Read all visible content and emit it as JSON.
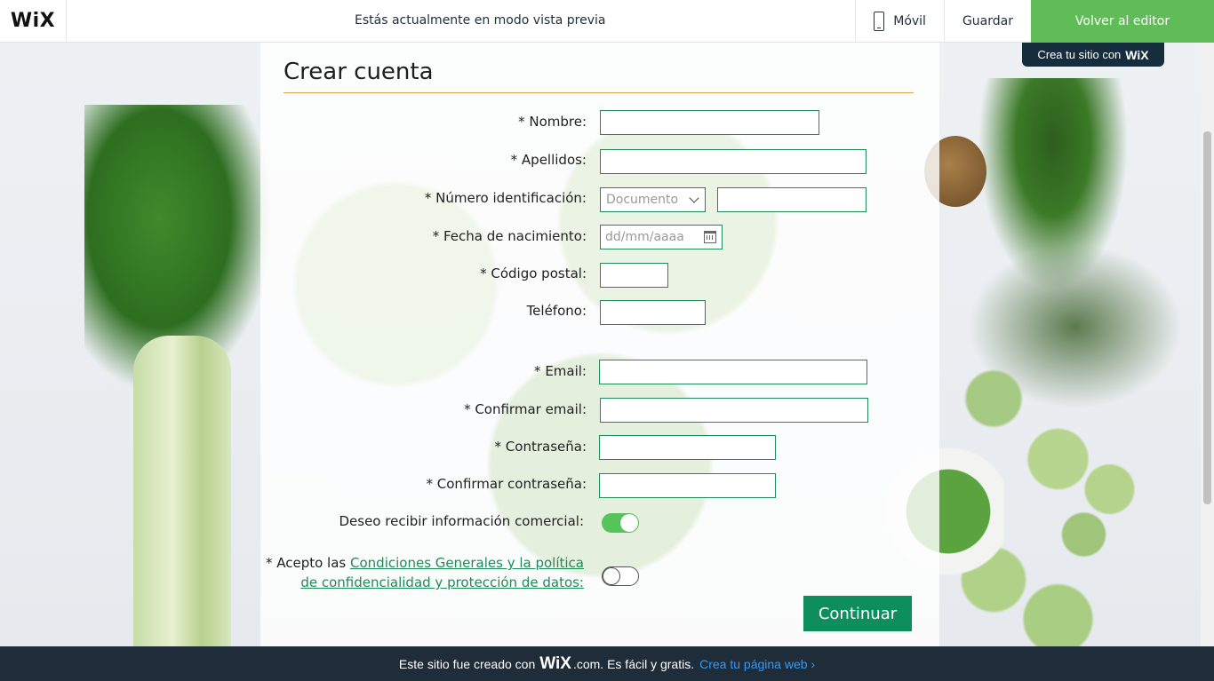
{
  "topbar": {
    "logo": "WiX",
    "preview_text": "Estás actualmente en modo vista previa",
    "mobile_label": "Móvil",
    "save_label": "Guardar",
    "editor_label": "Volver al editor"
  },
  "badge": {
    "text": "Crea tu sitio con",
    "brand": "WiX"
  },
  "form": {
    "title": "Crear cuenta",
    "fields": {
      "nombre": "* Nombre:",
      "apellidos": "* Apellidos:",
      "numero": "* Número identificación:",
      "fecha": "* Fecha de nacimiento:",
      "postal": "* Código postal:",
      "telefono": "Teléfono:",
      "email": "* Email:",
      "confirm_email": "* Confirmar email:",
      "password": "* Contraseña:",
      "confirm_password": "* Confirmar contraseña:",
      "comercial": "Deseo recibir información comercial:"
    },
    "document_select": "Documento",
    "date_placeholder": "dd/mm/aaaa",
    "terms_prefix": "* Acepto las",
    "terms_link_1": "Condiciones Generales y la política",
    "terms_link_2": "de confidencialidad y protección de datos:",
    "continue_label": "Continuar",
    "comercial_on": true,
    "terms_on": false
  },
  "footer": {
    "text_before": "Este sitio fue creado con",
    "brand": "WiX",
    "text_after": ".com. Es fácil y gratis.",
    "link": "Crea tu página web ›"
  },
  "colors": {
    "accent_green": "#60bc57",
    "input_border": "#1f8a5a",
    "button": "#0e8e5d",
    "footer_bg": "#1f2d3a",
    "link_blue": "#3899ec",
    "title_rule": "#d6a44b"
  }
}
